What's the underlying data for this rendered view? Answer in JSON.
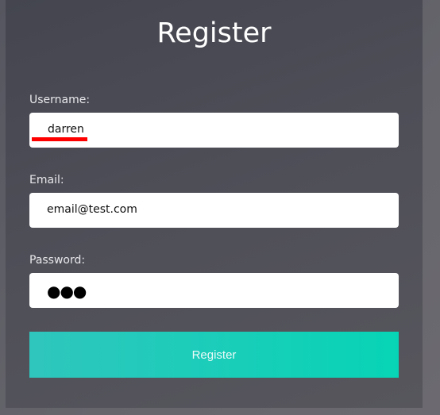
{
  "title": "Register",
  "form": {
    "username": {
      "label": "Username:",
      "value": "darren"
    },
    "email": {
      "label": "Email:",
      "value": "email@test.com"
    },
    "password": {
      "label": "Password:",
      "masked_value": "●●●"
    },
    "submit_label": "Register"
  },
  "colors": {
    "accent_start": "#2fc6bd",
    "accent_end": "#07d4b6",
    "annotation": "#ff0000"
  }
}
